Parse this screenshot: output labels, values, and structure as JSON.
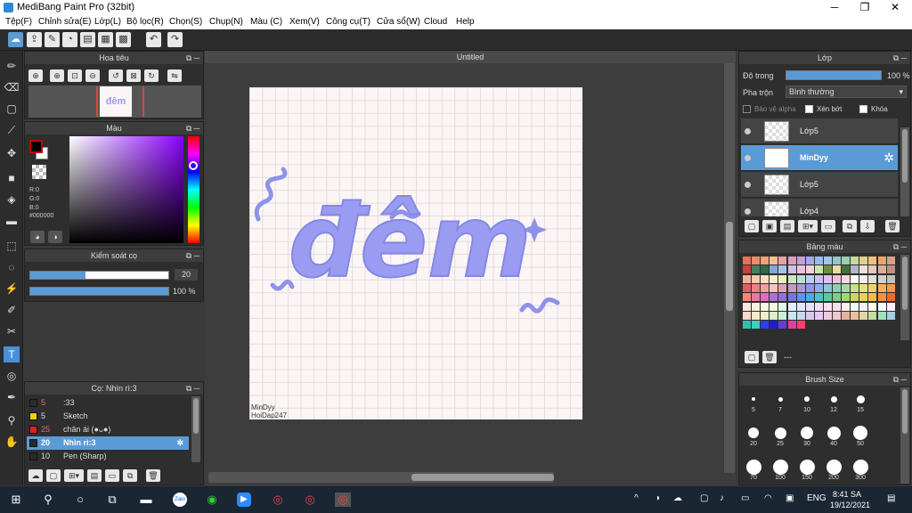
{
  "window": {
    "title": "MediBang Paint Pro (32bit)",
    "minimize": "─",
    "maximize": "❐",
    "close": "✕"
  },
  "menu": [
    "Tệp(F)",
    "Chỉnh sửa(E)",
    "Lớp(L)",
    "Bộ lọc(R)",
    "Chọn(S)",
    "Chụp(N)",
    "Màu (C)",
    "Xem(V)",
    "Công cụ(T)",
    "Cửa sổ(W)",
    "Cloud",
    "Help"
  ],
  "navigator": {
    "title": "Hoa tiêu",
    "preview_text": "đêm"
  },
  "color_panel": {
    "title": "Màu",
    "r": "R:0",
    "g": "G:0",
    "b": "B:0",
    "hex": "#000000"
  },
  "brush_control": {
    "title": "Kiểm soát cọ",
    "size": "20",
    "opacity": "100 %",
    "opacity_value": 100,
    "size_fill_fraction": 0.4
  },
  "brush_list": {
    "title": "Cọ: Nhìn rì:3",
    "items": [
      {
        "size": "5",
        "name": ":33",
        "color": "#2a2a2a"
      },
      {
        "size": "5",
        "name": "Sketch",
        "color": "#f2d000"
      },
      {
        "size": "25",
        "name": "chân ái (●ᴗ●)",
        "color": "#e02020"
      },
      {
        "size": "20",
        "name": "Nhìn rì:3",
        "color": "#2a2a2a"
      },
      {
        "size": "10",
        "name": "Pen (Sharp)",
        "color": "#2a2a2a"
      }
    ]
  },
  "canvas": {
    "tab": "Untitled",
    "artwork_text": "đêm",
    "artwork_color": "#9a9cf2",
    "watermark": [
      "MinDyy",
      "HoiDap247"
    ]
  },
  "layer_panel": {
    "title": "Lớp",
    "opacity_label": "Độ trong",
    "opacity_value": "100 %",
    "blend_label": "Pha trộn",
    "blend_value": "Bình thường",
    "protect_alpha": "Bảo vệ alpha",
    "clipping": "Xén bớt",
    "lock": "Khóa",
    "layers": [
      {
        "name": "Lớp5",
        "selected": false
      },
      {
        "name": "MinDyy",
        "selected": true
      },
      {
        "name": "Lớp5",
        "selected": false
      },
      {
        "name": "Lớp4",
        "selected": false
      }
    ]
  },
  "palette_panel": {
    "title": "Bảng màu",
    "footer": "---",
    "colors": [
      "#e8705a",
      "#f08a6a",
      "#f2a07a",
      "#f8c090",
      "#e8a0a8",
      "#d8a0c0",
      "#c0a0d8",
      "#a8a8e8",
      "#a0b8f0",
      "#a0c8e0",
      "#90c8c8",
      "#98d0a8",
      "#c8d8a0",
      "#e0d090",
      "#f0c080",
      "#f0a070",
      "#d8a088",
      "#c84040",
      "#408060",
      "#306848",
      "#80a8d8",
      "#a8c0e8",
      "#d0c0e8",
      "#f0c0e0",
      "#f8d0d8",
      "#c8e8a8",
      "#709040",
      "#e8e0a0",
      "#487038",
      "#b0b8c8",
      "#f0e0d8",
      "#e8c8b8",
      "#d8b098",
      "#c09080",
      "#f0b0a0",
      "#f8c8b0",
      "#f8e0c0",
      "#f8f0c8",
      "#e8f0c0",
      "#c8e8c0",
      "#b8e0d8",
      "#b8d0f0",
      "#c8c0f0",
      "#e0c0f0",
      "#f0c0d8",
      "#f8d8e0",
      "#ffffff",
      "#f0f0f0",
      "#e0e0e0",
      "#d0d0d0",
      "#c0c0c0",
      "#e06060",
      "#f08080",
      "#f0a0a0",
      "#f8c0c0",
      "#e0a0b8",
      "#c898c8",
      "#a898d8",
      "#9098e0",
      "#88b0e8",
      "#88c8d8",
      "#88d0b8",
      "#a8d898",
      "#c8e088",
      "#e8e080",
      "#f8d070",
      "#f8b060",
      "#f89850",
      "#f08878",
      "#e878a0",
      "#d870c0",
      "#b070d0",
      "#9070d8",
      "#7078e0",
      "#6090e8",
      "#50a8e0",
      "#50c0c8",
      "#58c8a0",
      "#78d080",
      "#a0d870",
      "#c8d868",
      "#e8d060",
      "#f8b850",
      "#f89040",
      "#f06830",
      "#f8e8e0",
      "#f8f0e0",
      "#f8f8e0",
      "#f0f8e0",
      "#e0f8e8",
      "#e0f0f8",
      "#e0e8f8",
      "#e8e0f8",
      "#f0e0f8",
      "#f8e0f0",
      "#f8e0e8",
      "#fff0f0",
      "#f0fff0",
      "#f0f0ff",
      "#fffff0",
      "#f0ffff",
      "#fff0ff",
      "#f8d8c8",
      "#f8e8c8",
      "#f0f0c8",
      "#d8f0c8",
      "#c8f0d8",
      "#c8e8f0",
      "#c8d8f0",
      "#d8c8f0",
      "#e8c8f0",
      "#f0c8e0",
      "#f0c8d0",
      "#e8b0a0",
      "#e8c0a0",
      "#e0d8a0",
      "#c0e0a0",
      "#a0e0c0",
      "#a0d0e0",
      "#30c0b0",
      "#40d0c0",
      "#3040e0",
      "#2020c0",
      "#6040d0",
      "#e040a0",
      "#f84070"
    ]
  },
  "brush_size_panel": {
    "title": "Brush Size",
    "sizes": [
      {
        "v": "5",
        "d": 4
      },
      {
        "v": "7",
        "d": 5
      },
      {
        "v": "10",
        "d": 6
      },
      {
        "v": "12",
        "d": 7
      },
      {
        "v": "15",
        "d": 9
      },
      {
        "v": "20",
        "d": 12
      },
      {
        "v": "25",
        "d": 13
      },
      {
        "v": "30",
        "d": 14
      },
      {
        "v": "40",
        "d": 15
      },
      {
        "v": "50",
        "d": 16
      },
      {
        "v": "70",
        "d": 17
      },
      {
        "v": "100",
        "d": 17
      },
      {
        "v": "150",
        "d": 17
      },
      {
        "v": "200",
        "d": 17
      },
      {
        "v": "300",
        "d": 17
      }
    ]
  },
  "taskbar": {
    "lang": "ENG",
    "time": "8:41 SA",
    "date": "19/12/2021"
  }
}
